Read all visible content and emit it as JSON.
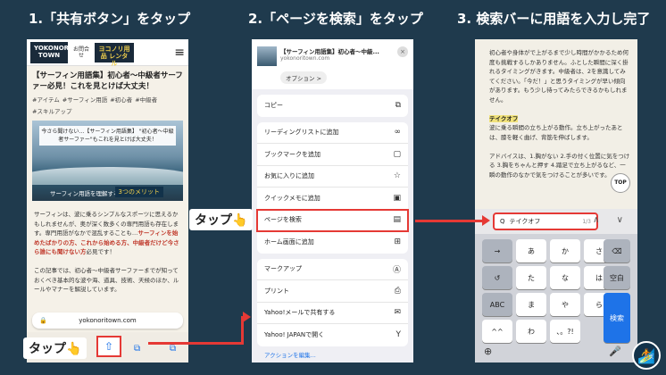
{
  "titles": {
    "step1": "1.「共有ボタン」をタップ",
    "step2": "2.「ページを検索」をタップ",
    "step3": "3. 検索バーに用語を入力し完了"
  },
  "panel1": {
    "logo": "YOKONORI TOWN",
    "hdr_icon_label": "お問合せ",
    "rental": "ヨコノリ用品 レンタル",
    "hamburger": "≡",
    "article_title": "【サーフィン用語集】初心者〜中級者サーファー必見！これを見とけば大丈夫！",
    "tags": [
      "#アイテム",
      "#サーフィン用語",
      "#初心者",
      "#中級者",
      "#スキルアップ"
    ],
    "hero_box": "今さら聞けない…【サーフィン用語集】 \"初心者〜中級者サーファー\"もこれを見とけば大丈夫！",
    "hero_sub": "サーフィン用語を理解する",
    "hero_merit": "3つのメリット",
    "body1": "サーフィンは、波に乗るシンプルなスポーツに思えるかもしれませんが、奥が深く数多くの専門用語も存在します。専門用語がなかで混乱することも…",
    "body1_hl": "サーフィンを始めたばかりの方、これから始める方、中級者だけど今さら誰にも聞けない方",
    "body1_end": "必見です！",
    "body2": "この記事では、初心者〜中級者サーファーまでが知っておくべき基本的な波や海、道具、技術、天候のほか、ルールやマナーを解説しています。",
    "url": "yokonoritown.com",
    "lock": "🔒",
    "share_icon": "⇧",
    "book_icon": "⧉",
    "tabs_icon": "⧉"
  },
  "panel2": {
    "share_title": "【サーフィン用語集】初心者〜中級...",
    "share_url": "yokonoritown.com",
    "options": "オプション >",
    "close": "×",
    "group1": [
      {
        "label": "コピー",
        "icon": "⧉"
      }
    ],
    "group2": [
      {
        "label": "リーディングリストに追加",
        "icon": "∞"
      },
      {
        "label": "ブックマークを追加",
        "icon": "▢"
      },
      {
        "label": "お気に入りに追加",
        "icon": "☆"
      },
      {
        "label": "クイックメモに追加",
        "icon": "▣"
      },
      {
        "label": "ページを検索",
        "icon": "▤"
      },
      {
        "label": "ホーム画面に追加",
        "icon": "⊞"
      }
    ],
    "group3": [
      {
        "label": "マークアップ",
        "icon": "Ⓐ"
      },
      {
        "label": "プリント",
        "icon": "⎙"
      },
      {
        "label": "Yahoo!メールで共有する",
        "icon": "✉"
      },
      {
        "label": "Yahoo! JAPANで開く",
        "icon": "Y"
      }
    ],
    "footer": "アクションを編集..."
  },
  "panel3": {
    "text1": "初心者や身体がで上がるまで少し時間がかかるため何度も挑戦するしかありません。ふとした瞬間に深く掛れるタイミングがきます。中級者は、2を意識してみてください。「今だ！」と思うタイミングが早い傾向があります。もう少し待ってみたらできるかもしれません。",
    "term": "テイクオフ",
    "text2": "波に乗る瞬間の立ち上がる動作。立ち上がったあとは、膝を軽く曲げ、背筋を伸ばします。",
    "text3": "アドバイスは、1.胸がない 2.手の付く位置に気をつける 3.胸をちゃんと押す 4.踏足で立ち上がるなど、一瞬の動作のなかで気をつけることが多いです。",
    "top": "TOP",
    "find_icon": "Q",
    "find_value": "テイクオフ",
    "find_count": "1/3",
    "find_arrows": "∧ ∨",
    "keys": [
      {
        "label": "→",
        "fn": true
      },
      {
        "label": "あ",
        "fn": false
      },
      {
        "label": "か",
        "fn": false
      },
      {
        "label": "さ",
        "fn": false
      },
      {
        "label": "⌫",
        "fn": true
      },
      {
        "label": "↺",
        "fn": true
      },
      {
        "label": "た",
        "fn": false
      },
      {
        "label": "な",
        "fn": false
      },
      {
        "label": "は",
        "fn": false
      },
      {
        "label": "空白",
        "fn": true
      },
      {
        "label": "ABC",
        "fn": true
      },
      {
        "label": "ま",
        "fn": false
      },
      {
        "label": "や",
        "fn": false
      },
      {
        "label": "ら",
        "fn": false
      },
      {
        "label": "☺",
        "fn": true
      },
      {
        "label": "^^",
        "fn": false
      },
      {
        "label": "わ",
        "fn": false
      },
      {
        "label": "、。?!",
        "fn": false
      }
    ],
    "search_key": "検索",
    "globe": "⊕",
    "mic": "🎤"
  },
  "overlays": {
    "tap1": "タップ👆",
    "tap2": "タップ👆",
    "badge": "🏄"
  }
}
